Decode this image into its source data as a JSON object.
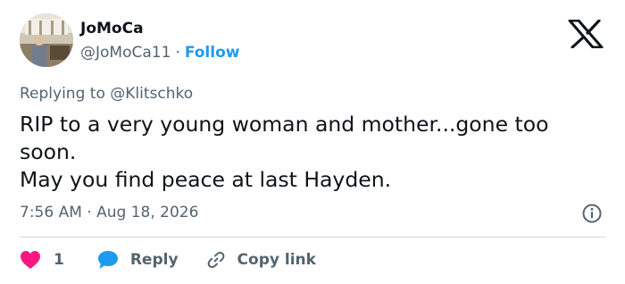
{
  "author": {
    "display_name": "JoMoCa",
    "handle": "@JoMoCa11",
    "separator": "·",
    "follow_label": "Follow"
  },
  "reply_to": {
    "prefix": "Replying to",
    "mention": "@Klitschko"
  },
  "tweet": {
    "line1": "RIP to a very young woman and mother...gone too soon.",
    "line2": "May you find peace at last Hayden."
  },
  "meta": {
    "time": "7:56 AM",
    "separator": "·",
    "date": "Aug 18, 2026"
  },
  "actions": {
    "like_count": "1",
    "reply_label": "Reply",
    "copy_label": "Copy link"
  },
  "icons": {
    "logo": "x-logo-icon",
    "info": "info-icon",
    "like": "heart-icon",
    "reply": "speech-bubble-icon",
    "copy": "link-icon"
  },
  "colors": {
    "text": "#0f1419",
    "secondary": "#536471",
    "accent": "#1d9bf0",
    "like": "#f91880",
    "divider": "#cfd9de"
  }
}
